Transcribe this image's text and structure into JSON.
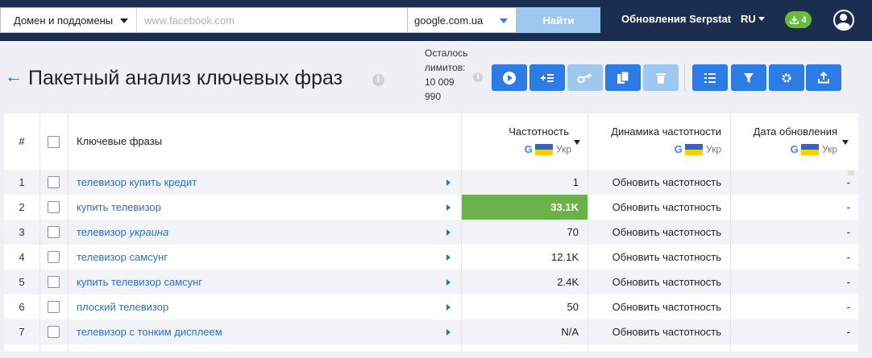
{
  "topbar": {
    "domain_mode": "Домен и поддомены",
    "search_placeholder": "www.facebook.com",
    "search_value": "",
    "search_engine": "google.com.ua",
    "find_label": "Найти",
    "updates_label": "Обновления Serpstat",
    "language": "RU",
    "downloads_count": "4"
  },
  "header": {
    "back_arrow": "←",
    "title": "Пакетный анализ ключевых фраз",
    "info_glyph": "i",
    "limits_line1": "Осталось",
    "limits_line2": "лимитов:",
    "limits_line3": "10 009",
    "limits_line4": "990",
    "toolbar_icons": [
      "play-icon",
      "add-list-icon",
      "key-icon",
      "copy-icon",
      "trash-icon",
      "columns-icon",
      "filter-icon",
      "settings-icon",
      "export-icon"
    ]
  },
  "table": {
    "headers": {
      "num": "#",
      "keyword": "Ключевые фразы",
      "freq": "Частотность",
      "dynamics": "Динамика частотности",
      "date": "Дата обновления",
      "g": "G",
      "region": "Укр"
    },
    "rows": [
      {
        "num": "1",
        "keyword": "телевизор купить кредит",
        "keyword_tail": "",
        "freq": "1",
        "dynamics": "Обновить частотность",
        "date": "-"
      },
      {
        "num": "2",
        "keyword": "купить телевизор",
        "keyword_tail": "",
        "freq": "33.1K",
        "dynamics": "Обновить частотность",
        "date": "-"
      },
      {
        "num": "3",
        "keyword": "телевизор ",
        "keyword_tail": "украина",
        "freq": "70",
        "dynamics": "Обновить частотность",
        "date": "-"
      },
      {
        "num": "4",
        "keyword": "телевизор самсунг",
        "keyword_tail": "",
        "freq": "12.1K",
        "dynamics": "Обновить частотность",
        "date": "-"
      },
      {
        "num": "5",
        "keyword": "купить телевизор самсунг",
        "keyword_tail": "",
        "freq": "2.4K",
        "dynamics": "Обновить частотность",
        "date": "-"
      },
      {
        "num": "6",
        "keyword": "плоский телевизор",
        "keyword_tail": "",
        "freq": "50",
        "dynamics": "Обновить частотность",
        "date": "-"
      },
      {
        "num": "7",
        "keyword": "телевизор с тонким дисплеем",
        "keyword_tail": "",
        "freq": "N/A",
        "dynamics": "Обновить частотность",
        "date": "-"
      }
    ]
  },
  "colors": {
    "topbar": "#1c2e4f",
    "accent": "#2d7be5",
    "accent_disabled": "#9ec8f0",
    "link": "#2c6fc3",
    "highlight": "#6cb24a",
    "badge": "#69bb3f"
  }
}
